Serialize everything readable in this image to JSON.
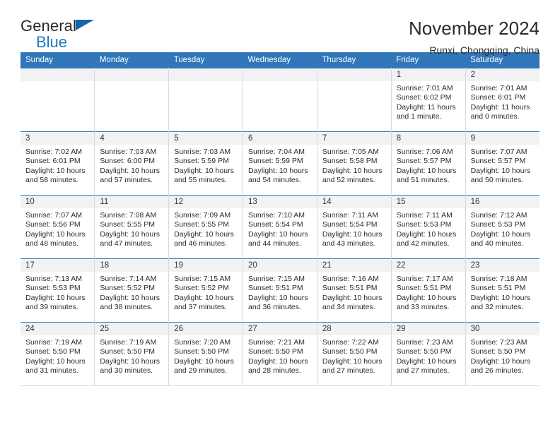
{
  "logo": {
    "word_one": "General",
    "word_two": "Blue",
    "triangle_icon": "blue-triangle-icon",
    "brand_color": "#1f7bc1"
  },
  "header": {
    "title": "November 2024",
    "subtitle": "Runxi, Chongqing, China"
  },
  "calendar": {
    "header_color": "#3076b8",
    "daynum_band_color": "#f2f2f2",
    "weekdays": [
      "Sunday",
      "Monday",
      "Tuesday",
      "Wednesday",
      "Thursday",
      "Friday",
      "Saturday"
    ],
    "labels": {
      "sunrise": "Sunrise:",
      "sunset": "Sunset:",
      "daylight": "Daylight:"
    },
    "weeks": [
      [
        {
          "day": "",
          "empty": true
        },
        {
          "day": "",
          "empty": true
        },
        {
          "day": "",
          "empty": true
        },
        {
          "day": "",
          "empty": true
        },
        {
          "day": "",
          "empty": true
        },
        {
          "day": "1",
          "sunrise": "Sunrise: 7:01 AM",
          "sunset": "Sunset: 6:02 PM",
          "daylight": "Daylight: 11 hours and 1 minute."
        },
        {
          "day": "2",
          "sunrise": "Sunrise: 7:01 AM",
          "sunset": "Sunset: 6:01 PM",
          "daylight": "Daylight: 11 hours and 0 minutes."
        }
      ],
      [
        {
          "day": "3",
          "sunrise": "Sunrise: 7:02 AM",
          "sunset": "Sunset: 6:01 PM",
          "daylight": "Daylight: 10 hours and 58 minutes."
        },
        {
          "day": "4",
          "sunrise": "Sunrise: 7:03 AM",
          "sunset": "Sunset: 6:00 PM",
          "daylight": "Daylight: 10 hours and 57 minutes."
        },
        {
          "day": "5",
          "sunrise": "Sunrise: 7:03 AM",
          "sunset": "Sunset: 5:59 PM",
          "daylight": "Daylight: 10 hours and 55 minutes."
        },
        {
          "day": "6",
          "sunrise": "Sunrise: 7:04 AM",
          "sunset": "Sunset: 5:59 PM",
          "daylight": "Daylight: 10 hours and 54 minutes."
        },
        {
          "day": "7",
          "sunrise": "Sunrise: 7:05 AM",
          "sunset": "Sunset: 5:58 PM",
          "daylight": "Daylight: 10 hours and 52 minutes."
        },
        {
          "day": "8",
          "sunrise": "Sunrise: 7:06 AM",
          "sunset": "Sunset: 5:57 PM",
          "daylight": "Daylight: 10 hours and 51 minutes."
        },
        {
          "day": "9",
          "sunrise": "Sunrise: 7:07 AM",
          "sunset": "Sunset: 5:57 PM",
          "daylight": "Daylight: 10 hours and 50 minutes."
        }
      ],
      [
        {
          "day": "10",
          "sunrise": "Sunrise: 7:07 AM",
          "sunset": "Sunset: 5:56 PM",
          "daylight": "Daylight: 10 hours and 48 minutes."
        },
        {
          "day": "11",
          "sunrise": "Sunrise: 7:08 AM",
          "sunset": "Sunset: 5:55 PM",
          "daylight": "Daylight: 10 hours and 47 minutes."
        },
        {
          "day": "12",
          "sunrise": "Sunrise: 7:09 AM",
          "sunset": "Sunset: 5:55 PM",
          "daylight": "Daylight: 10 hours and 46 minutes."
        },
        {
          "day": "13",
          "sunrise": "Sunrise: 7:10 AM",
          "sunset": "Sunset: 5:54 PM",
          "daylight": "Daylight: 10 hours and 44 minutes."
        },
        {
          "day": "14",
          "sunrise": "Sunrise: 7:11 AM",
          "sunset": "Sunset: 5:54 PM",
          "daylight": "Daylight: 10 hours and 43 minutes."
        },
        {
          "day": "15",
          "sunrise": "Sunrise: 7:11 AM",
          "sunset": "Sunset: 5:53 PM",
          "daylight": "Daylight: 10 hours and 42 minutes."
        },
        {
          "day": "16",
          "sunrise": "Sunrise: 7:12 AM",
          "sunset": "Sunset: 5:53 PM",
          "daylight": "Daylight: 10 hours and 40 minutes."
        }
      ],
      [
        {
          "day": "17",
          "sunrise": "Sunrise: 7:13 AM",
          "sunset": "Sunset: 5:53 PM",
          "daylight": "Daylight: 10 hours and 39 minutes."
        },
        {
          "day": "18",
          "sunrise": "Sunrise: 7:14 AM",
          "sunset": "Sunset: 5:52 PM",
          "daylight": "Daylight: 10 hours and 38 minutes."
        },
        {
          "day": "19",
          "sunrise": "Sunrise: 7:15 AM",
          "sunset": "Sunset: 5:52 PM",
          "daylight": "Daylight: 10 hours and 37 minutes."
        },
        {
          "day": "20",
          "sunrise": "Sunrise: 7:15 AM",
          "sunset": "Sunset: 5:51 PM",
          "daylight": "Daylight: 10 hours and 36 minutes."
        },
        {
          "day": "21",
          "sunrise": "Sunrise: 7:16 AM",
          "sunset": "Sunset: 5:51 PM",
          "daylight": "Daylight: 10 hours and 34 minutes."
        },
        {
          "day": "22",
          "sunrise": "Sunrise: 7:17 AM",
          "sunset": "Sunset: 5:51 PM",
          "daylight": "Daylight: 10 hours and 33 minutes."
        },
        {
          "day": "23",
          "sunrise": "Sunrise: 7:18 AM",
          "sunset": "Sunset: 5:51 PM",
          "daylight": "Daylight: 10 hours and 32 minutes."
        }
      ],
      [
        {
          "day": "24",
          "sunrise": "Sunrise: 7:19 AM",
          "sunset": "Sunset: 5:50 PM",
          "daylight": "Daylight: 10 hours and 31 minutes."
        },
        {
          "day": "25",
          "sunrise": "Sunrise: 7:19 AM",
          "sunset": "Sunset: 5:50 PM",
          "daylight": "Daylight: 10 hours and 30 minutes."
        },
        {
          "day": "26",
          "sunrise": "Sunrise: 7:20 AM",
          "sunset": "Sunset: 5:50 PM",
          "daylight": "Daylight: 10 hours and 29 minutes."
        },
        {
          "day": "27",
          "sunrise": "Sunrise: 7:21 AM",
          "sunset": "Sunset: 5:50 PM",
          "daylight": "Daylight: 10 hours and 28 minutes."
        },
        {
          "day": "28",
          "sunrise": "Sunrise: 7:22 AM",
          "sunset": "Sunset: 5:50 PM",
          "daylight": "Daylight: 10 hours and 27 minutes."
        },
        {
          "day": "29",
          "sunrise": "Sunrise: 7:23 AM",
          "sunset": "Sunset: 5:50 PM",
          "daylight": "Daylight: 10 hours and 27 minutes."
        },
        {
          "day": "30",
          "sunrise": "Sunrise: 7:23 AM",
          "sunset": "Sunset: 5:50 PM",
          "daylight": "Daylight: 10 hours and 26 minutes."
        }
      ]
    ]
  }
}
